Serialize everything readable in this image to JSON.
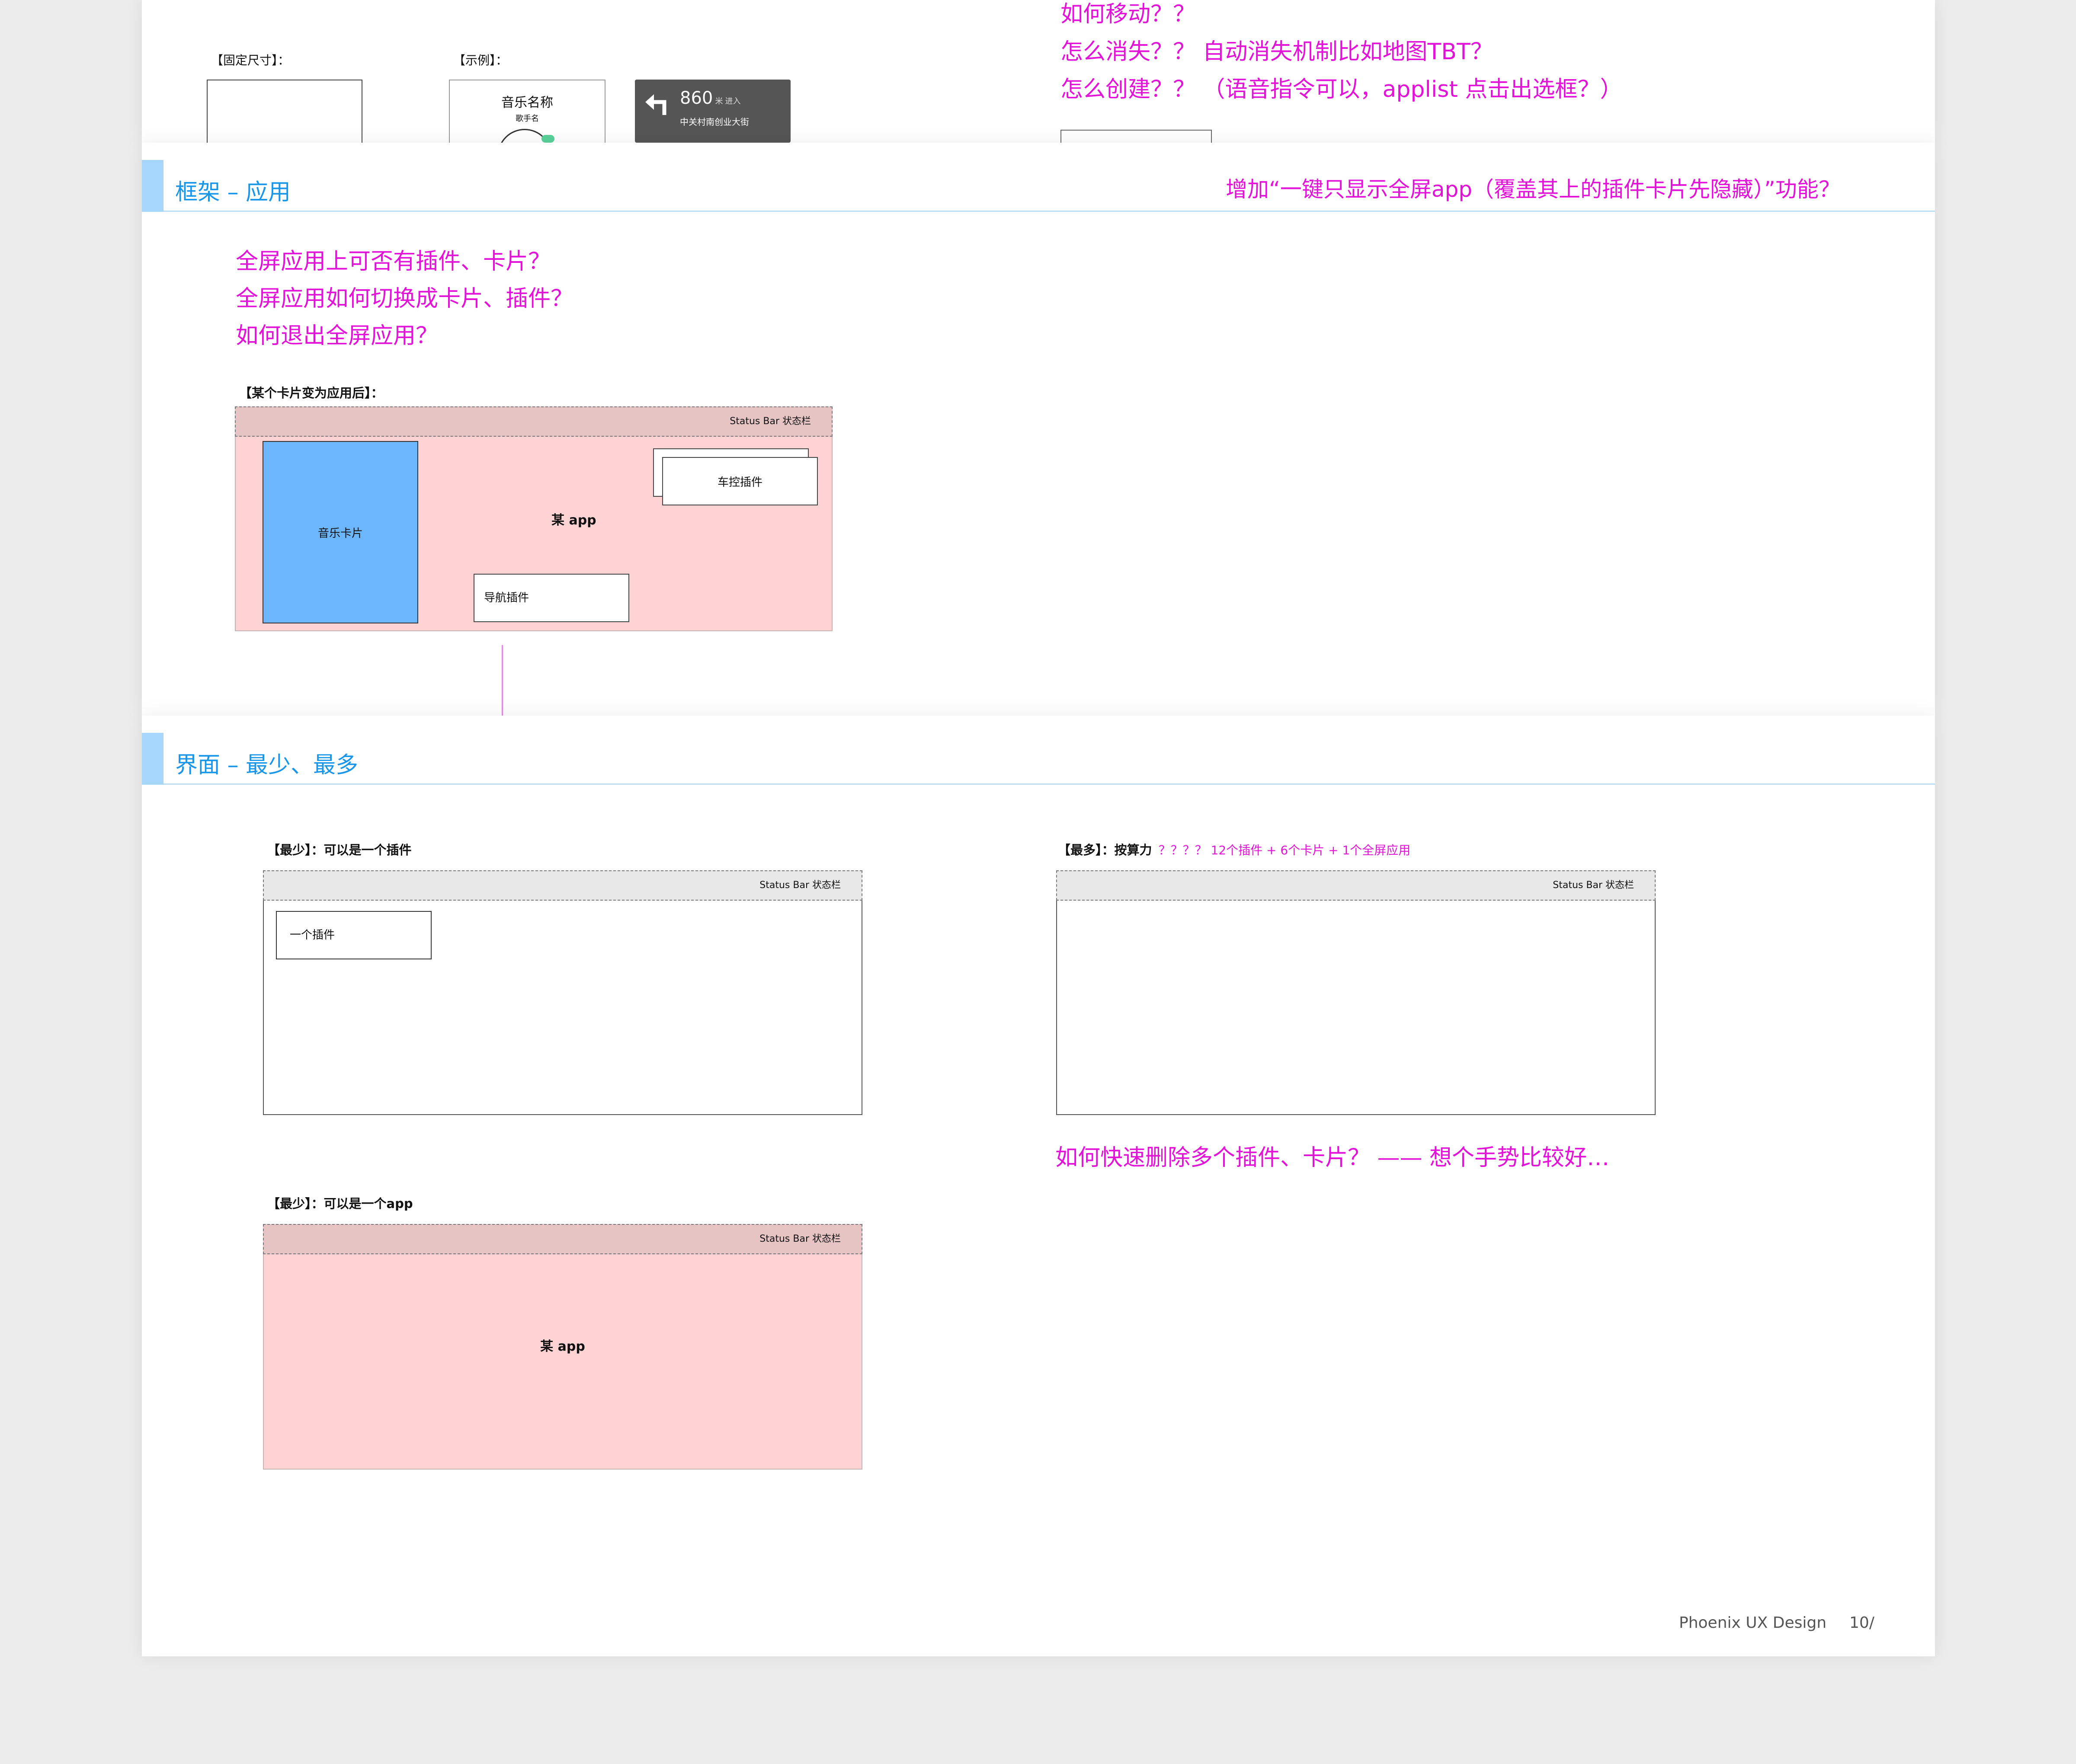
{
  "top_section": {
    "fixed_size_label": "【固定尺寸】：",
    "example_label": "【示例】：",
    "music_card": {
      "title": "音乐名称",
      "artist": "歌手名"
    },
    "nav_card": {
      "arrow_icon": "turn-left-arrow-icon",
      "distance": "860",
      "unit": "米",
      "action": "进入",
      "street": "中关村南创业大街"
    },
    "questions": [
      "如何移动？？",
      "怎么消失？？ 自动消失机制比如地图TBT？",
      "怎么创建？？ （语音指令可以，applist 点击出选框？）"
    ]
  },
  "framework_section": {
    "title": "框架 – 应用",
    "note": "增加“一键只显示全屏app（覆盖其上的插件卡片先隐藏）”功能？",
    "questions": [
      "全屏应用上可否有插件、卡片？",
      "全屏应用如何切换成卡片、插件？",
      "如何退出全屏应用？"
    ],
    "diagram_label": "【某个卡片变为应用后】：",
    "status_bar": "Status Bar 状态栏",
    "app_label": "某 app",
    "music_card": "音乐卡片",
    "car_plugin": "车控插件",
    "nav_plugin": "导航插件"
  },
  "interface_section": {
    "title": "界面 – 最少、最多",
    "min_plugin_label": "【最少】：可以是一个插件",
    "status_bar": "Status Bar 状态栏",
    "one_plugin": "一个插件",
    "max_label": "【最多】：按算力",
    "max_note": "？？？？  12个插件 + 6个卡片 + 1个全屏应用",
    "delete_question": "如何快速删除多个插件、卡片？ —— 想个手势比较好…",
    "min_app_label": "【最少】：可以是一个app",
    "app_label": "某 app"
  },
  "footer": {
    "brand": "Phoenix UX Design",
    "page": "10/"
  },
  "colors": {
    "annotation": "#e312d8",
    "section_title": "#1796ea",
    "app_fill": "#ffd3d3",
    "music_card_fill": "#6bb6fc"
  }
}
